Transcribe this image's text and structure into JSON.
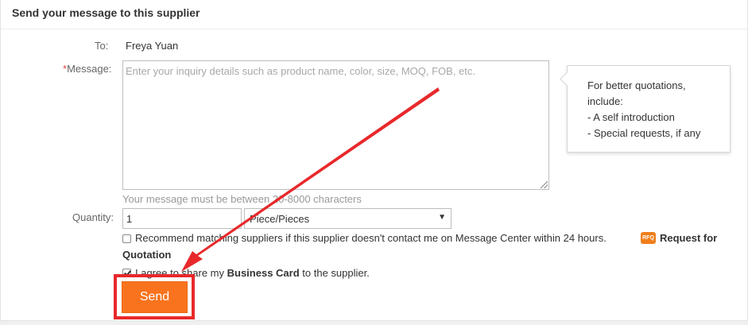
{
  "panel": {
    "title": "Send your message to this supplier"
  },
  "form": {
    "to_label": "To:",
    "to_value": "Freya Yuan",
    "message_required_mark": "*",
    "message_label": "Message:",
    "message_placeholder": "Enter your inquiry details such as product name, color, size, MOQ, FOB, etc.",
    "message_value": "",
    "message_hint": "Your message must be between 20-8000 characters",
    "quantity_label": "Quantity:",
    "quantity_value": "1",
    "unit_selected": "Piece/Pieces"
  },
  "tip": {
    "lines": [
      "For better quotations,",
      "include:",
      "- A self introduction",
      "- Special requests, if any"
    ]
  },
  "options": {
    "recommend_text": "Recommend matching suppliers if this supplier doesn't contact me on Message Center within 24 hours.",
    "recommend_checked": false,
    "rfq_icon_text": "RFQ",
    "rfq_link_part1": "Request for",
    "rfq_link_part2": "Quotation",
    "share_text_pre": "I agree to share my ",
    "share_text_bold": "Business Card",
    "share_text_post": " to the supplier.",
    "share_checked": true
  },
  "actions": {
    "send_label": "Send"
  },
  "colors": {
    "accent": "#f9731e",
    "annotation": "#e8282b",
    "required": "#e64545"
  }
}
